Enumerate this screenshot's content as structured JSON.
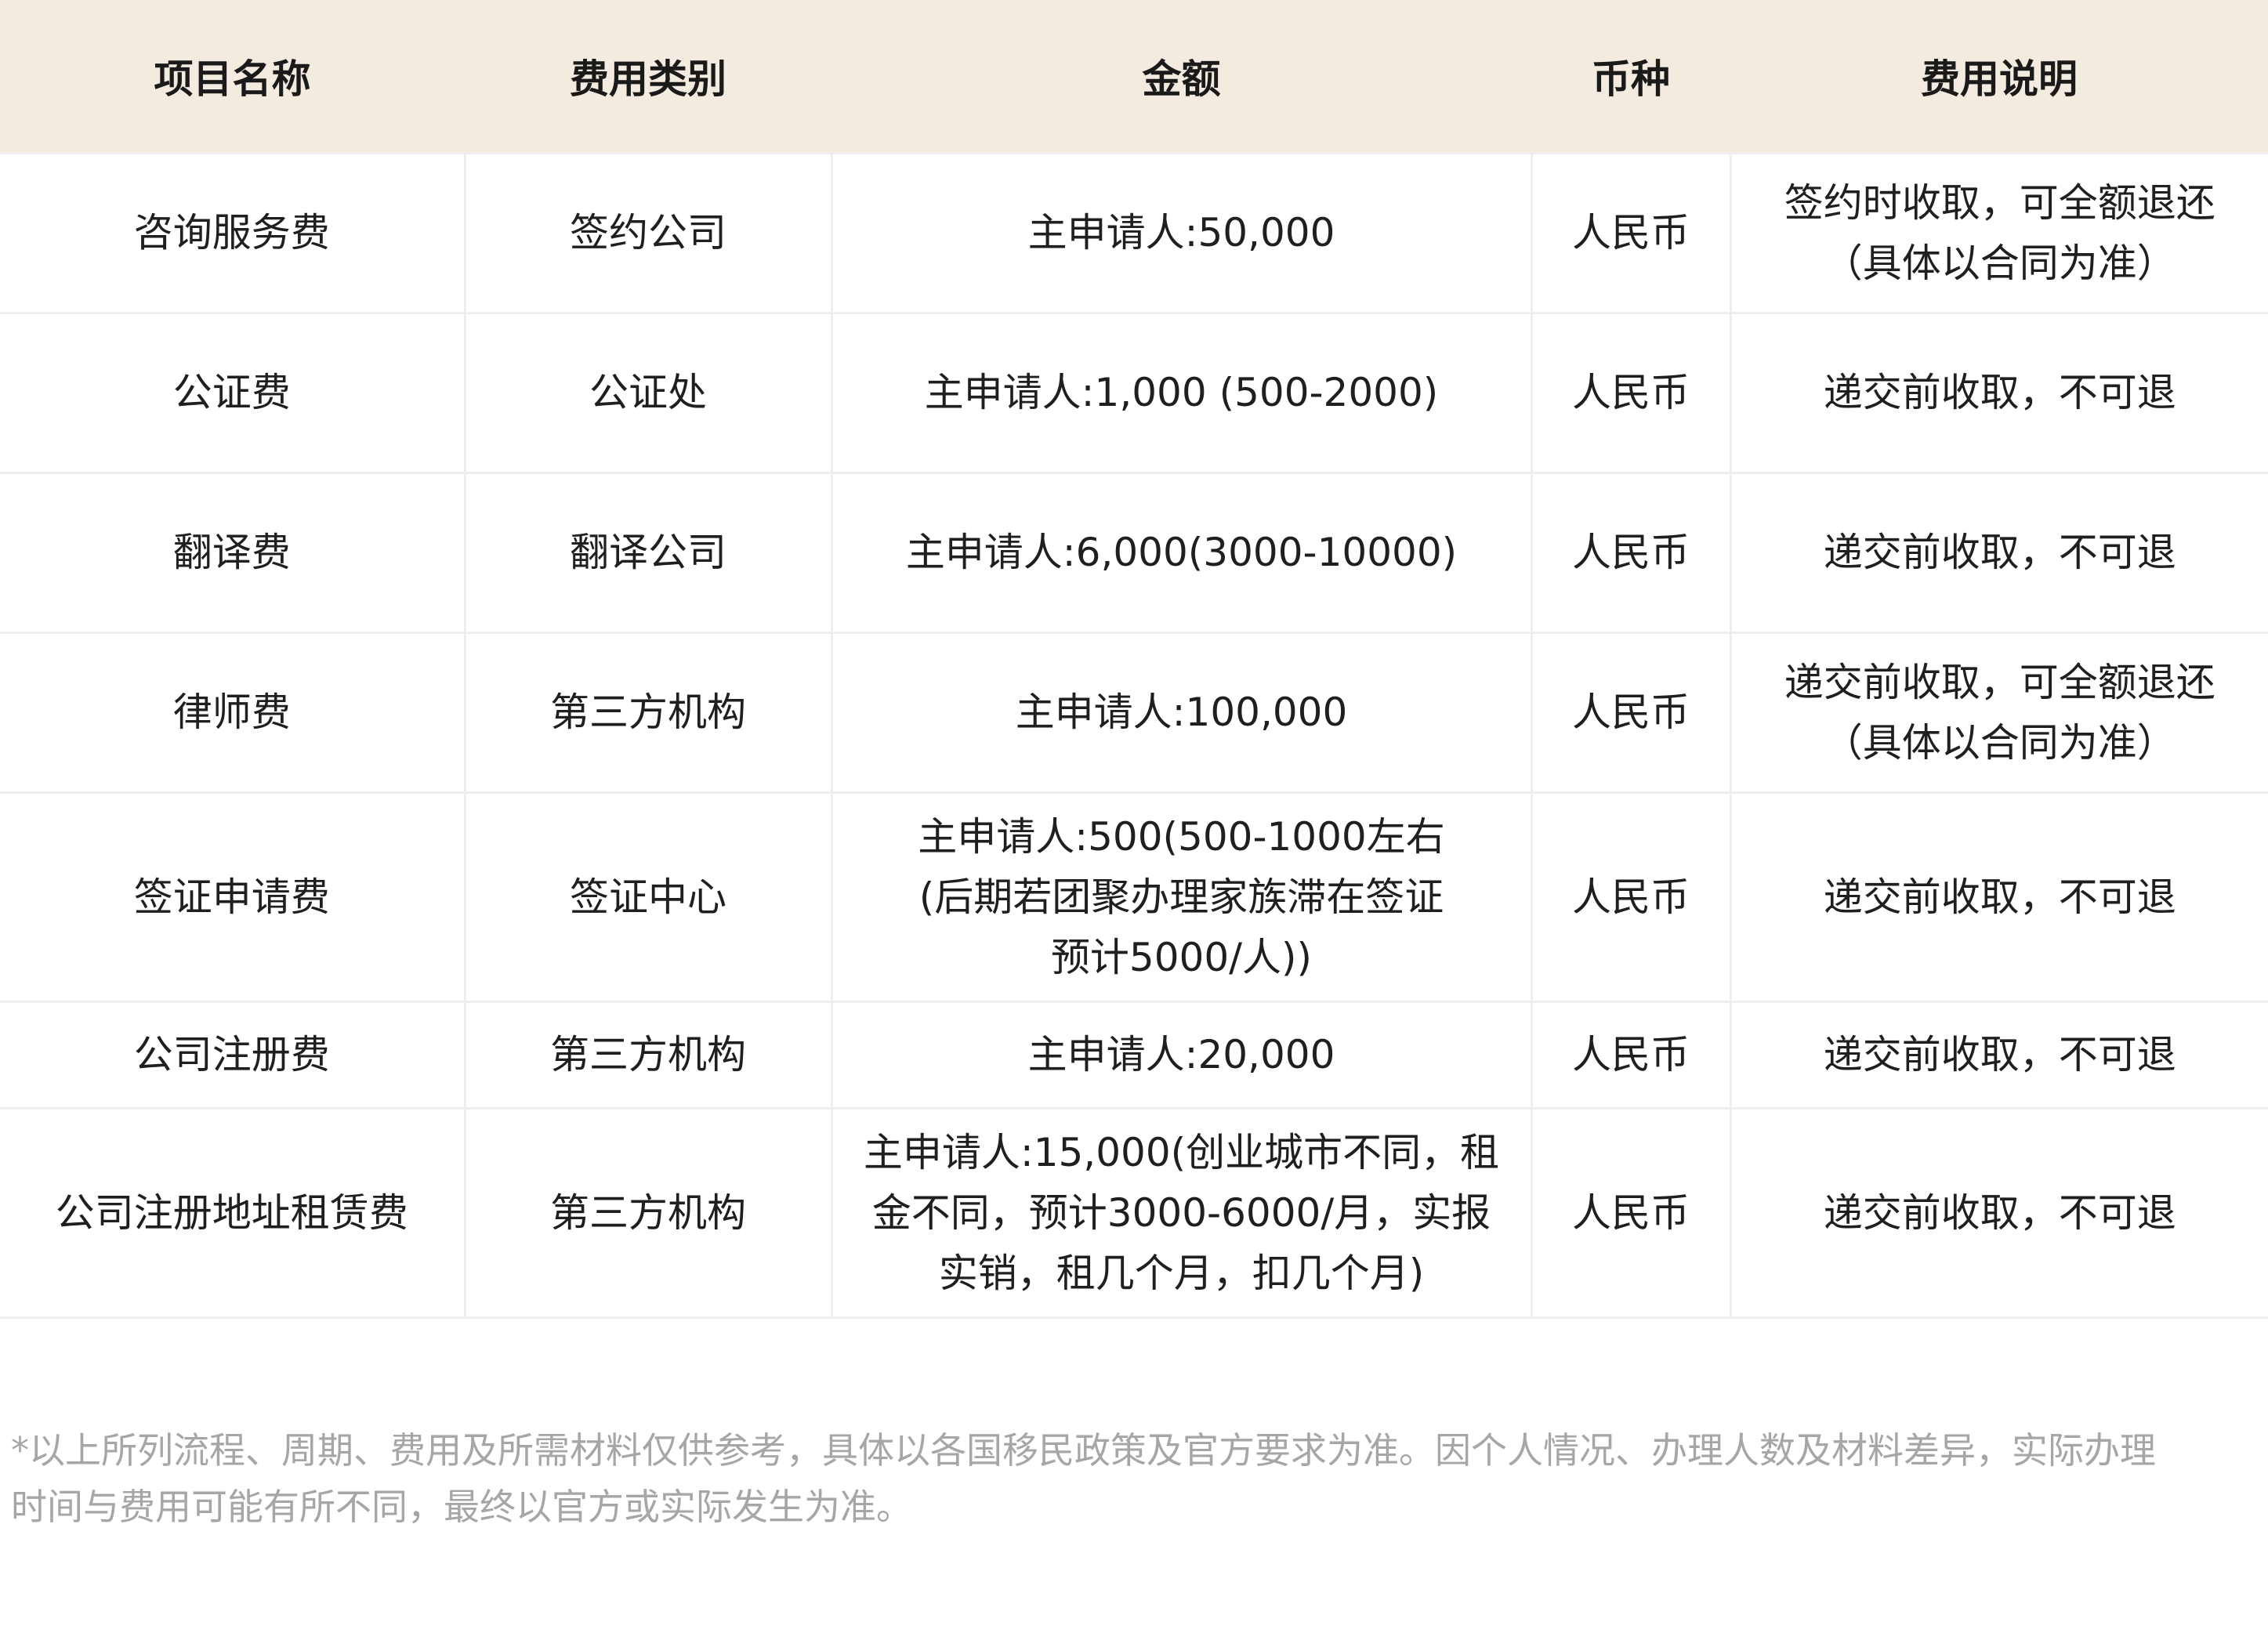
{
  "table": {
    "headers": [
      "项目名称",
      "费用类别",
      "金额",
      "币种",
      "费用说明"
    ],
    "rows": [
      {
        "name": "咨询服务费",
        "category": "签约公司",
        "amount": [
          "主申请人:50,000"
        ],
        "currency": "人民币",
        "note": [
          "签约时收取，可全额退还",
          "（具体以合同为准）"
        ]
      },
      {
        "name": "公证费",
        "category": "公证处",
        "amount": [
          "主申请人:1,000 (500-2000)"
        ],
        "currency": "人民币",
        "note": [
          "递交前收取，不可退"
        ]
      },
      {
        "name": "翻译费",
        "category": "翻译公司",
        "amount": [
          "主申请人:6,000(3000-10000)"
        ],
        "currency": "人民币",
        "note": [
          "递交前收取，不可退"
        ]
      },
      {
        "name": "律师费",
        "category": "第三方机构",
        "amount": [
          "主申请人:100,000"
        ],
        "currency": "人民币",
        "note": [
          "递交前收取，可全额退还",
          "（具体以合同为准）"
        ]
      },
      {
        "name": "签证申请费",
        "category": "签证中心",
        "amount": [
          "主申请人:500(500-1000左右",
          "(后期若团聚办理家族滞在签证",
          "预计5000/人))"
        ],
        "currency": "人民币",
        "note": [
          "递交前收取，不可退"
        ]
      },
      {
        "name": "公司注册费",
        "category": "第三方机构",
        "amount": [
          "主申请人:20,000"
        ],
        "currency": "人民币",
        "note": [
          "递交前收取，不可退"
        ]
      },
      {
        "name": "公司注册地址租赁费",
        "category": "第三方机构",
        "amount": [
          "主申请人:15,000(创业城市不同，租",
          "金不同，预计3000-6000/月，实报",
          "实销，租几个月，扣几个月)"
        ],
        "currency": "人民币",
        "note": [
          "递交前收取，不可退"
        ]
      }
    ]
  },
  "disclaimer": [
    "*以上所列流程、周期、费用及所需材料仅供参考，具体以各国移民政策及官方要求为准。因个人情况、办理人数及材料差异，实际办理",
    "时间与费用可能有所不同，最终以官方或实际发生为准。"
  ]
}
